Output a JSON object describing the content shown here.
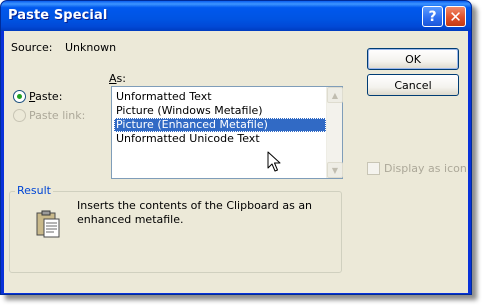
{
  "window": {
    "title": "Paste Special"
  },
  "titlebar_buttons": {
    "help": "?",
    "close": "✕"
  },
  "source": {
    "label": "Source:",
    "value": "Unknown"
  },
  "as_label": {
    "underlined": "A",
    "rest": "s:"
  },
  "options": {
    "paste": {
      "underlined": "P",
      "rest": "aste:",
      "selected": true
    },
    "paste_link": {
      "label": "Paste link:",
      "enabled": false
    }
  },
  "list": {
    "items": [
      "Unformatted Text",
      "Picture (Windows Metafile)",
      "Picture (Enhanced Metafile)",
      "Unformatted Unicode Text"
    ],
    "selected_index": 2
  },
  "buttons": {
    "ok": "OK",
    "cancel": "Cancel"
  },
  "display_as_icon": {
    "label": "Display as icon",
    "checked": false,
    "enabled": false
  },
  "result": {
    "label": "Result",
    "text": "Inserts the contents of the Clipboard as an enhanced metafile.",
    "icon": "clipboard-icon"
  },
  "colors": {
    "titlebar": "#0054e3",
    "dialog_bg": "#ece9d8",
    "selection": "#316ac5",
    "result_label": "#0046d5"
  }
}
